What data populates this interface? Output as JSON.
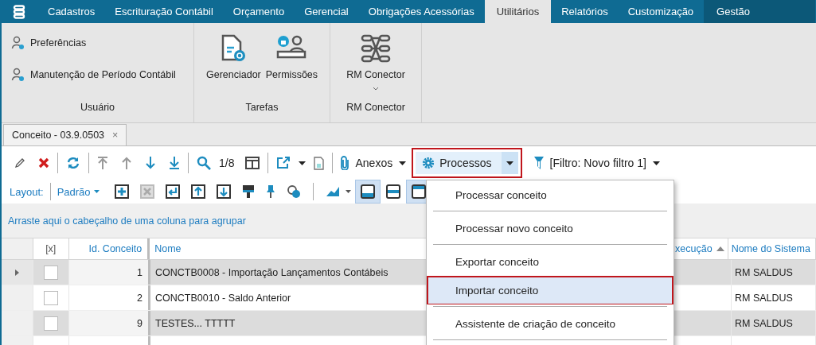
{
  "menu_bar": {
    "items": [
      {
        "label": "Cadastros",
        "selected": false,
        "dark": false
      },
      {
        "label": "Escrituração Contábil",
        "selected": false,
        "dark": false
      },
      {
        "label": "Orçamento",
        "selected": false,
        "dark": false
      },
      {
        "label": "Gerencial",
        "selected": false,
        "dark": false
      },
      {
        "label": "Obrigações Acessórias",
        "selected": false,
        "dark": false
      },
      {
        "label": "Utilitários",
        "selected": true,
        "dark": false
      },
      {
        "label": "Relatórios",
        "selected": false,
        "dark": false
      },
      {
        "label": "Customização",
        "selected": false,
        "dark": false
      },
      {
        "label": "Gestão",
        "selected": false,
        "dark": true
      }
    ]
  },
  "ribbon": {
    "groups": [
      {
        "label": "Usuário",
        "kind": "small",
        "buttons": [
          {
            "label": "Preferências"
          },
          {
            "label": "Manutenção de Período Contábil"
          }
        ]
      },
      {
        "label": "Tarefas",
        "kind": "large",
        "buttons": [
          {
            "label": "Gerenciador"
          },
          {
            "label": "Permissões"
          }
        ]
      },
      {
        "label": "RM Conector",
        "kind": "large",
        "buttons": [
          {
            "label": "RM Conector"
          }
        ]
      }
    ]
  },
  "document_tab": {
    "title": "Conceito - 03.9.0503",
    "close": "×"
  },
  "toolbar": {
    "record_counter": "1/8",
    "attachments": "Anexos",
    "processes": {
      "label": "Processos",
      "highlighted": true
    },
    "filter": "[Filtro: Novo filtro 1]"
  },
  "layout_bar": {
    "label": "Layout:",
    "layout": "Padrão",
    "view_toggles": [
      {
        "selected": true
      },
      {
        "selected": false
      },
      {
        "selected": true
      }
    ]
  },
  "group_panel": {
    "hint": "Arraste aqui o cabeçalho de uma coluna para agrupar"
  },
  "grid": {
    "columns": [
      "[x]",
      "Id. Conceito",
      "Nome",
      "xecução",
      "Nome do Sistema"
    ],
    "rows": [
      {
        "current": true,
        "checked": false,
        "id": "1",
        "name": "CONCTB0008 - Importação Lançamentos Contábeis",
        "system": "RM SALDUS"
      },
      {
        "current": false,
        "checked": false,
        "id": "2",
        "name": "CONCTB0010 - Saldo Anterior",
        "system": "RM SALDUS"
      },
      {
        "current": false,
        "checked": false,
        "id": "9",
        "name": "TESTES... TTTTT",
        "system": "RM SALDUS"
      }
    ]
  },
  "processes_menu": {
    "items": [
      {
        "label": "Processar conceito",
        "selected": false,
        "highlighted": false,
        "separator_after": true
      },
      {
        "label": "Processar novo conceito",
        "selected": false,
        "highlighted": false,
        "separator_after": true
      },
      {
        "label": "Exportar conceito",
        "selected": false,
        "highlighted": false,
        "separator_after": false
      },
      {
        "label": "Importar conceito",
        "selected": true,
        "highlighted": true,
        "separator_after": true
      },
      {
        "label": "Assistente de criação de conceito",
        "selected": false,
        "highlighted": false,
        "separator_after": true
      }
    ]
  }
}
